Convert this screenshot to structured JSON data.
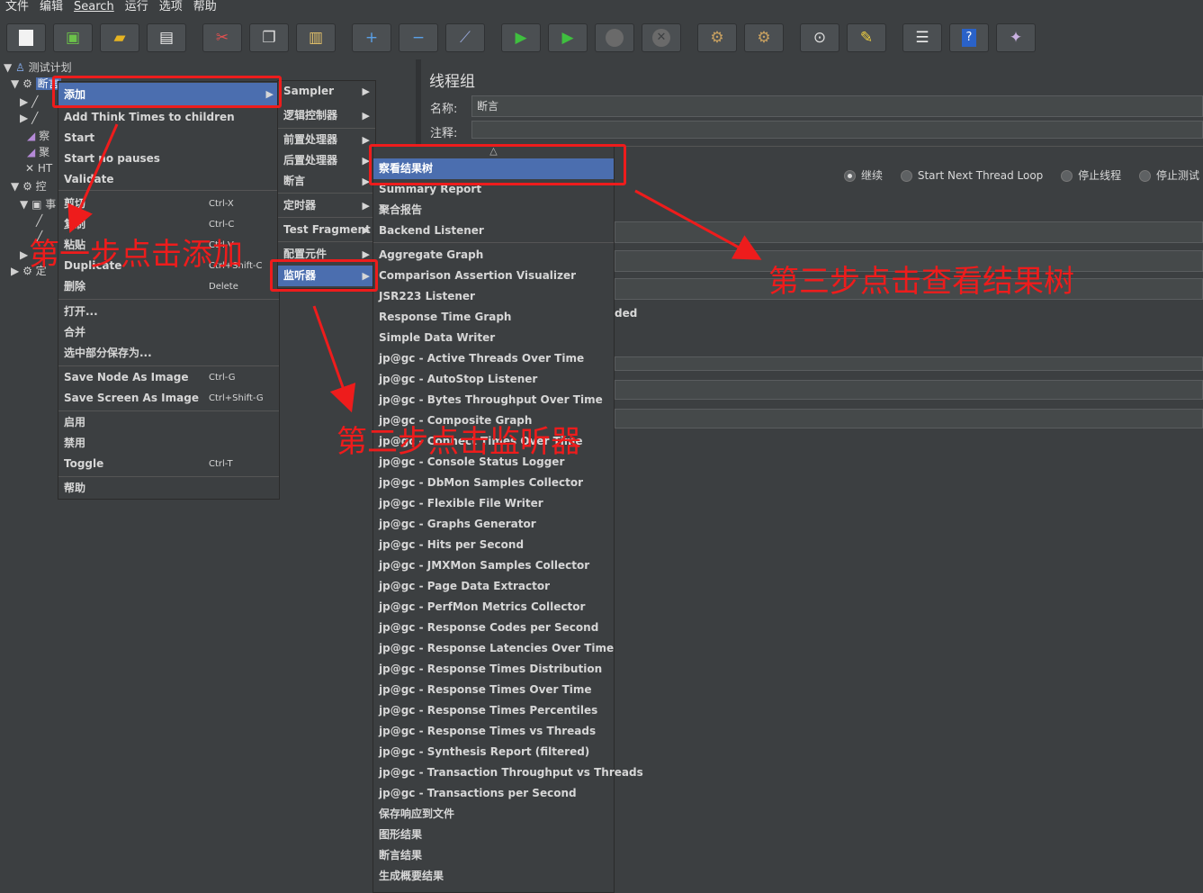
{
  "menubar": [
    "文件",
    "编辑",
    "Search",
    "运行",
    "选项",
    "帮助"
  ],
  "toolbar_icons": [
    "new-icon",
    "templates-icon",
    "open-icon",
    "save-icon",
    "cut-icon",
    "copy-icon",
    "paste-icon",
    "expand-icon",
    "collapse-icon",
    "toggle-icon",
    "start-icon",
    "start-no-pauses-icon",
    "stop-icon",
    "shutdown-icon",
    "clear-icon",
    "clear-all-icon",
    "search-icon",
    "reset-search-icon",
    "function-helper-icon",
    "help-icon",
    "remote-icon"
  ],
  "tree": {
    "root": "测试计划",
    "selected": "断言",
    "partial": [
      "察",
      "聚",
      "HT",
      "控",
      "事",
      "定"
    ]
  },
  "context_menu": {
    "add": "添加",
    "items": [
      {
        "label": "Add Think Times to children",
        "shortcut": ""
      },
      {
        "label": "Start",
        "shortcut": ""
      },
      {
        "label": "Start no pauses",
        "shortcut": ""
      },
      {
        "label": "Validate",
        "shortcut": ""
      },
      {
        "label": "剪切",
        "shortcut": "Ctrl-X"
      },
      {
        "label": "复制",
        "shortcut": "Ctrl-C"
      },
      {
        "label": "粘贴",
        "shortcut": "Ctrl-V"
      },
      {
        "label": "Duplicate",
        "shortcut": "Ctrl+Shift-C"
      },
      {
        "label": "删除",
        "shortcut": "Delete"
      },
      {
        "label": "打开...",
        "shortcut": ""
      },
      {
        "label": "合并",
        "shortcut": ""
      },
      {
        "label": "选中部分保存为...",
        "shortcut": ""
      },
      {
        "label": "Save Node As Image",
        "shortcut": "Ctrl-G"
      },
      {
        "label": "Save Screen As Image",
        "shortcut": "Ctrl+Shift-G"
      },
      {
        "label": "启用",
        "shortcut": ""
      },
      {
        "label": "禁用",
        "shortcut": ""
      },
      {
        "label": "Toggle",
        "shortcut": "Ctrl-T"
      },
      {
        "label": "帮助",
        "shortcut": ""
      }
    ]
  },
  "add_submenu": [
    "Sampler",
    "逻辑控制器",
    "前置处理器",
    "后置处理器",
    "断言",
    "定时器",
    "Test Fragment",
    "配置元件",
    "监听器"
  ],
  "listener_submenu": {
    "scroll_up": "△",
    "items": [
      "察看结果树",
      "Summary Report",
      "聚合报告",
      "Backend Listener",
      "Aggregate Graph",
      "Comparison Assertion Visualizer",
      "JSR223 Listener",
      "Response Time Graph",
      "Simple Data Writer",
      "jp@gc - Active Threads Over Time",
      "jp@gc - AutoStop Listener",
      "jp@gc - Bytes Throughput Over Time",
      "jp@gc - Composite Graph",
      "jp@gc - Connect Times Over Time",
      "jp@gc - Console Status Logger",
      "jp@gc - DbMon Samples Collector",
      "jp@gc - Flexible File Writer",
      "jp@gc - Graphs Generator",
      "jp@gc - Hits per Second",
      "jp@gc - JMXMon Samples Collector",
      "jp@gc - Page Data Extractor",
      "jp@gc - PerfMon Metrics Collector",
      "jp@gc - Response Codes per Second",
      "jp@gc - Response Latencies Over Time",
      "jp@gc - Response Times Distribution",
      "jp@gc - Response Times Over Time",
      "jp@gc - Response Times Percentiles",
      "jp@gc - Response Times vs Threads",
      "jp@gc - Synthesis Report (filtered)",
      "jp@gc - Transaction Throughput vs Threads",
      "jp@gc - Transactions per Second",
      "保存响应到文件",
      "图形结果",
      "断言结果",
      "生成概要结果"
    ]
  },
  "panel": {
    "title": "线程组",
    "name_label": "名称:",
    "name_value": "断言",
    "comment_label": "注释:",
    "radios": [
      "继续",
      "Start Next Thread Loop",
      "停止线程",
      "停止测试"
    ],
    "partial_text": "ded"
  },
  "annotations": {
    "step1": "第一步点击添加",
    "step2": "第二步点击监听器",
    "step3": "第三步点击查看结果树"
  },
  "colors": {
    "highlight": "#4b6eaf",
    "annotation": "#ee1c1c",
    "background": "#3c3f41"
  }
}
